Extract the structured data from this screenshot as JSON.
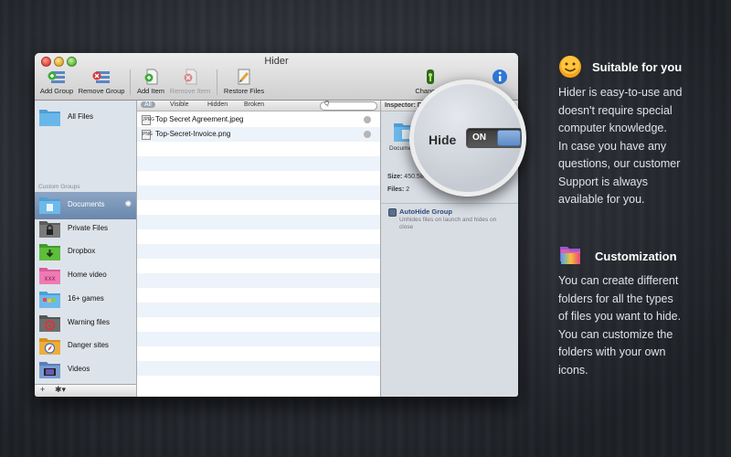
{
  "window": {
    "title": "Hider",
    "toolbar": {
      "add_group": "Add Group",
      "remove_group": "Remove Group",
      "add_item": "Add Item",
      "remove_item": "Remove Item",
      "restore_files": "Restore Files",
      "change_password": "Change P",
      "help": "o"
    },
    "sidebar": {
      "all_files": "All Files",
      "section_label": "Custom Groups",
      "items": [
        {
          "label": "Documents",
          "icon": "documents-folder-icon",
          "selected": true
        },
        {
          "label": "Private Files",
          "icon": "lock-folder-icon"
        },
        {
          "label": "Dropbox",
          "icon": "dropbox-folder-icon"
        },
        {
          "label": "Home video",
          "icon": "xxx-folder-icon"
        },
        {
          "label": "16+ games",
          "icon": "games-folder-icon"
        },
        {
          "label": "Warning files",
          "icon": "biohazard-folder-icon"
        },
        {
          "label": "Danger sites",
          "icon": "safari-folder-icon"
        },
        {
          "label": "Videos",
          "icon": "film-folder-icon"
        }
      ],
      "bottom_add": "+",
      "bottom_gear": "✱▾"
    },
    "list": {
      "filters": [
        "All",
        "Visible",
        "Hidden",
        "Broken"
      ],
      "search_placeholder": "Q",
      "files": [
        {
          "name": "Top Secret Agreement.jpeg",
          "type": "JPEG"
        },
        {
          "name": "Top-Secret-Invoice.png",
          "type": "PNG"
        }
      ]
    },
    "inspector": {
      "header": "Inspector: D",
      "folder_name": "Documen",
      "size_label": "Size:",
      "size_value": "450.58",
      "files_label": "Files:",
      "files_value": "2",
      "autohide_title": "AutoHide Group",
      "autohide_desc": "Unhides files on launch and hides on close"
    },
    "magnifier": {
      "hide_label": "Hide",
      "toggle_value": "ON"
    }
  },
  "features": [
    {
      "icon": "smiley-icon",
      "title": "Suitable for you",
      "text": "Hider is easy-to-use and\ndoesn't require special\ncomputer knowledge.\nIn case you have any\nquestions, our customer\nSupport is always\navailable for you."
    },
    {
      "icon": "folders-icon",
      "title": "Customization",
      "text": "You can create different\nfolders for all the types\nof files you want to hide.\nYou can customize the\nfolders with your own\nicons."
    }
  ]
}
